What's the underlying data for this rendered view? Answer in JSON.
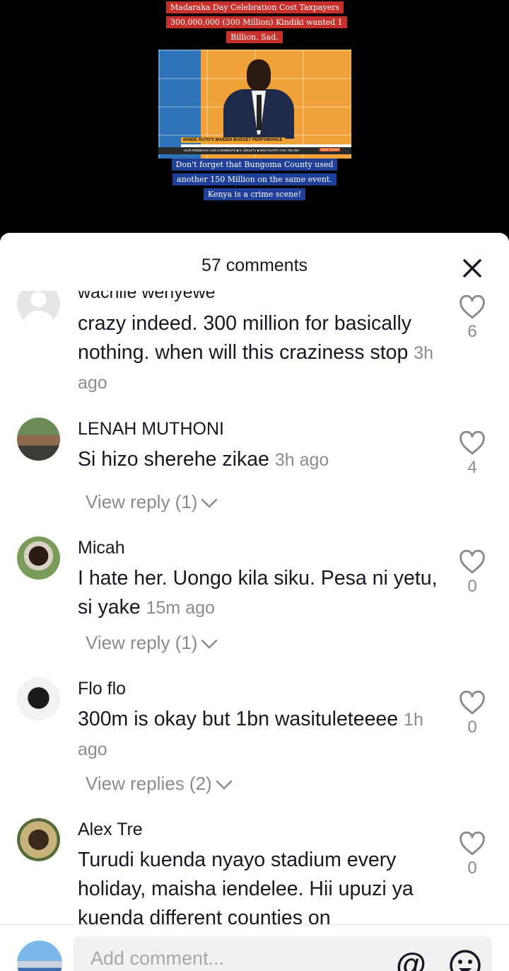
{
  "video": {
    "caption_top": "Madaraka Day Celebration Cost Taxpayers 300,000,000 (300 Million) Kindiki wanted 1 Billion. Sad.",
    "caption_bottom": "Don't forget that Bungoma County used another 150 Million on the same event. Kenya is a crime scene!",
    "news_tag": "INSIDE RUTO'S MAIDEN BUDGET PERFOMANCE",
    "news_headline": "ORDINARY REVENUE COLLECTED WAS KSH 2.29T",
    "news_ticker": "OUR FEEDBACK AND COMMENTS  ■ X: @K24TV  ■ WHATSAPP: 0757 705 083",
    "news_time": "SMS: 21222"
  },
  "sheet": {
    "comment_count": "57 comments"
  },
  "comments": [
    {
      "username": "wachiie wenyewe",
      "text": "crazy indeed. 300 million for basically nothing. when will this craziness stop",
      "timestamp": "3h ago",
      "likes": "6",
      "view_reply": ""
    },
    {
      "username": "LENAH MUTHONI",
      "text": "Si hizo sherehe zikae",
      "timestamp": "3h ago",
      "likes": "4",
      "view_reply": "View reply (1)"
    },
    {
      "username": "Micah",
      "text": "I hate her. Uongo kila siku. Pesa ni yetu, si yake",
      "timestamp": "15m ago",
      "likes": "0",
      "view_reply": "View reply (1)"
    },
    {
      "username": "Flo flo",
      "text": "300m is okay but 1bn wasituleteeee",
      "timestamp": "1h ago",
      "likes": "0",
      "view_reply": "View replies (2)"
    },
    {
      "username": "Alex Tre",
      "text": "Turudi kuenda nyayo stadium every holiday, maisha iendelee. Hii upuzi ya kuenda different counties on",
      "timestamp": "",
      "likes": "0",
      "view_reply": ""
    }
  ],
  "input": {
    "placeholder": "Add comment..."
  },
  "icons": {
    "close": "close-icon",
    "like": "heart-outline-icon",
    "chevron": "chevron-down-icon",
    "mention": "at-icon",
    "emoji": "emoji-icon"
  },
  "colors": {
    "text": "#161823",
    "secondary": "#8a8b91",
    "caption_red": "#c8302b",
    "caption_blue": "#1f3f99"
  }
}
